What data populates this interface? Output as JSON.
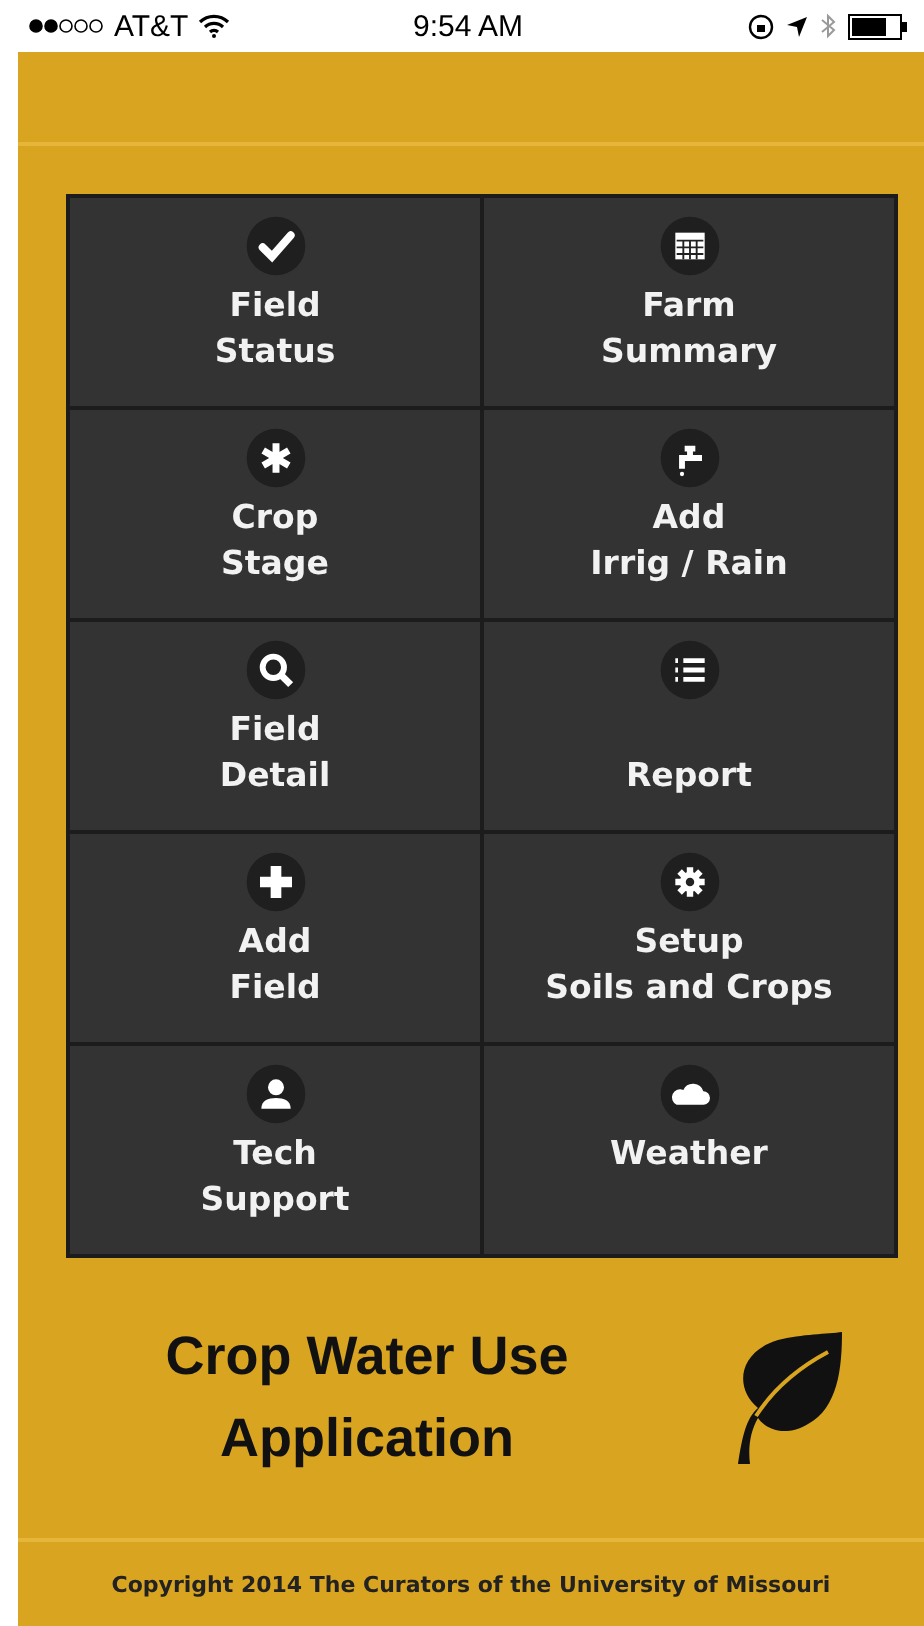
{
  "status_bar": {
    "carrier": "AT&T",
    "time": "9:54 AM"
  },
  "menu": [
    {
      "lines": [
        "Field",
        "Status"
      ]
    },
    {
      "lines": [
        "Farm",
        "Summary"
      ]
    },
    {
      "lines": [
        "Crop",
        "Stage"
      ]
    },
    {
      "lines": [
        "Add",
        "Irrig / Rain"
      ]
    },
    {
      "lines": [
        "Field",
        "Detail"
      ]
    },
    {
      "lines": [
        "Report"
      ]
    },
    {
      "lines": [
        "Add",
        "Field"
      ]
    },
    {
      "lines": [
        "Setup",
        "Soils and Crops"
      ]
    },
    {
      "lines": [
        "Tech",
        "Support"
      ]
    },
    {
      "lines": [
        "Weather"
      ]
    }
  ],
  "app_title": "Crop Water Use Application",
  "footer": "Copyright  2014 The Curators of the University of Missouri"
}
